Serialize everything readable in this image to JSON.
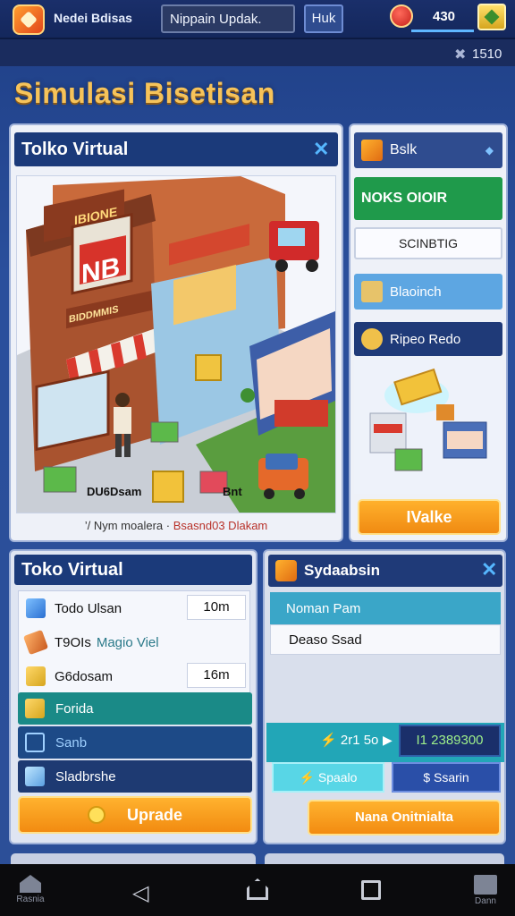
{
  "topbar": {
    "app_name": "Nedei Bdisas",
    "search_value": "Nippain Updak.",
    "hub_label": "Huk",
    "coins": "430",
    "counter": "1510"
  },
  "page_title": "Simulasi Bisetisan",
  "store_panel": {
    "title": "Tolko Virtual",
    "caption_left": "’/ Nym moalera",
    "caption_sep": "·",
    "caption_right": "Bsasnd03 Dlakam",
    "sign_big": "NB",
    "sign_top": "IBIONE",
    "sign_shop": "BIDDMMIS",
    "label_bottom_left": "DU6Dsam",
    "label_bottom_right": "Bnt"
  },
  "right_col": {
    "head": "Bslk",
    "green": "NOKS OIOIR",
    "white": "SCINBTIG",
    "blue": "Blaoinch",
    "dark": "Ripeo Redo",
    "make": "IValke"
  },
  "inventory": {
    "title": "Toko Virtual",
    "rows": [
      {
        "label": "Todo Ulsan",
        "value": "10m"
      },
      {
        "label": "T9OIs",
        "highlight": "Magio Viel",
        "value": ""
      },
      {
        "label": "G6dosam",
        "value": "16m"
      }
    ],
    "categories": [
      {
        "label": "Forida",
        "color": "#1a8a87"
      },
      {
        "label": "Sanb",
        "color": "#1d4a87"
      },
      {
        "label": "Sladbrshe",
        "color": "#1e3a72"
      }
    ],
    "upgrade": "Uprade"
  },
  "side_panel": {
    "title": "Sydaabsin",
    "sub1": "Noman Pam",
    "sub2": "Deaso Ssad",
    "stat1": "2r1 5o",
    "stat2": "I1 2389300",
    "btn1": "Spaalo",
    "btn2": "Ssarin",
    "action": "Nana Onitnialta"
  },
  "navbar": {
    "home": "Rasnia",
    "store": "Dann"
  },
  "colors": {
    "accent_orange": "#f28b11",
    "header_blue": "#1b3a7a",
    "title_gold": "#f6c35a"
  }
}
